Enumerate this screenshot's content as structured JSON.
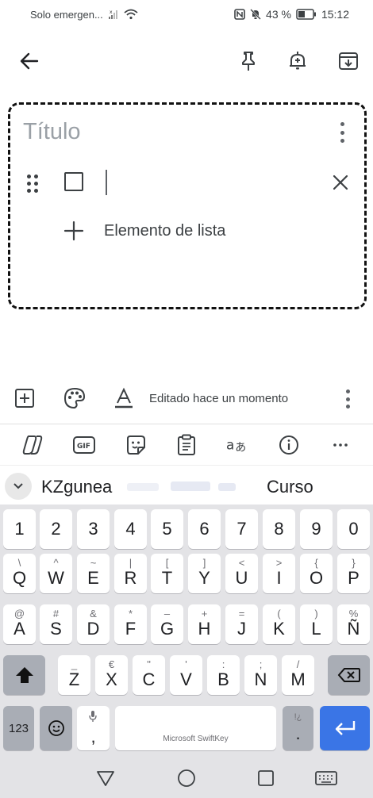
{
  "status_bar": {
    "carrier": "Solo emergen...",
    "battery_percent": "43 %",
    "time": "15:12"
  },
  "note": {
    "title_placeholder": "Título",
    "list_item_text": "",
    "add_item_label": "Elemento de lista"
  },
  "note_toolbar": {
    "edited_label": "Editado hace un momento"
  },
  "keyboard": {
    "suggestions": [
      "KZgunea",
      "Curso"
    ],
    "number_row": [
      "1",
      "2",
      "3",
      "4",
      "5",
      "6",
      "7",
      "8",
      "9",
      "0"
    ],
    "row1": [
      {
        "main": "Q",
        "sub": "\\"
      },
      {
        "main": "W",
        "sub": "^"
      },
      {
        "main": "E",
        "sub": "~"
      },
      {
        "main": "R",
        "sub": "|"
      },
      {
        "main": "T",
        "sub": "["
      },
      {
        "main": "Y",
        "sub": "]"
      },
      {
        "main": "U",
        "sub": "<"
      },
      {
        "main": "I",
        "sub": ">"
      },
      {
        "main": "O",
        "sub": "{"
      },
      {
        "main": "P",
        "sub": "}"
      }
    ],
    "row2": [
      {
        "main": "A",
        "sub": "@"
      },
      {
        "main": "S",
        "sub": "#"
      },
      {
        "main": "D",
        "sub": "&"
      },
      {
        "main": "F",
        "sub": "*"
      },
      {
        "main": "G",
        "sub": "–"
      },
      {
        "main": "H",
        "sub": "+"
      },
      {
        "main": "J",
        "sub": "="
      },
      {
        "main": "K",
        "sub": "("
      },
      {
        "main": "L",
        "sub": ")"
      },
      {
        "main": "Ñ",
        "sub": "%"
      }
    ],
    "row3": [
      {
        "main": "Z",
        "sub": "_"
      },
      {
        "main": "X",
        "sub": "€"
      },
      {
        "main": "C",
        "sub": "\""
      },
      {
        "main": "V",
        "sub": "'"
      },
      {
        "main": "B",
        "sub": ":"
      },
      {
        "main": "N",
        "sub": ";"
      },
      {
        "main": "M",
        "sub": "/"
      }
    ],
    "symbols_key": "123",
    "comma_key": ",",
    "period_key": ".",
    "period_sub": "!¿",
    "space_label": "Microsoft SwiftKey"
  }
}
